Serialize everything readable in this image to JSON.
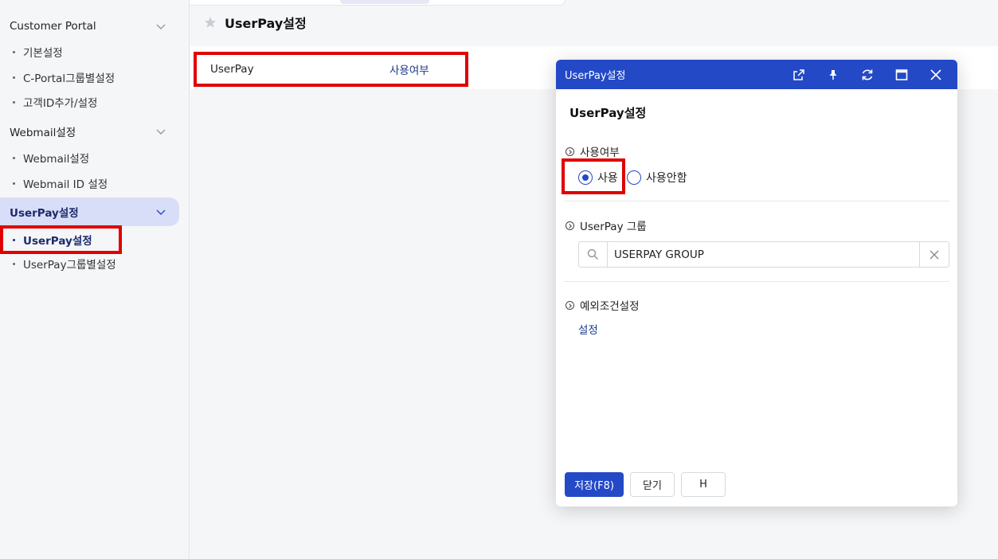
{
  "sidebar": {
    "groups": [
      {
        "label": "Customer Portal",
        "items": [
          "기본설정",
          "C-Portal그룹별설정",
          "고객ID추가/설정"
        ]
      },
      {
        "label": "Webmail설정",
        "items": [
          "Webmail설정",
          "Webmail ID 설정"
        ]
      },
      {
        "label": "UserPay설정",
        "items": [
          "UserPay설정",
          "UserPay그룹별설정"
        ]
      }
    ]
  },
  "main": {
    "title": "UserPay설정",
    "row": {
      "name": "UserPay",
      "value": "사용여부"
    }
  },
  "dialog": {
    "header_title": "UserPay설정",
    "title": "UserPay설정",
    "sections": {
      "usage": {
        "label": "사용여부",
        "options": [
          "사용",
          "사용안함"
        ],
        "selected": "사용"
      },
      "group": {
        "label": "UserPay 그룹",
        "value": "USERPAY GROUP"
      },
      "exception": {
        "label": "예외조건설정",
        "link": "설정"
      }
    },
    "buttons": {
      "save": "저장(F8)",
      "close": "닫기",
      "h": "H"
    }
  },
  "colors": {
    "accent": "#2449c7",
    "highlight": "#e00000",
    "active_bg": "#d9def8"
  }
}
